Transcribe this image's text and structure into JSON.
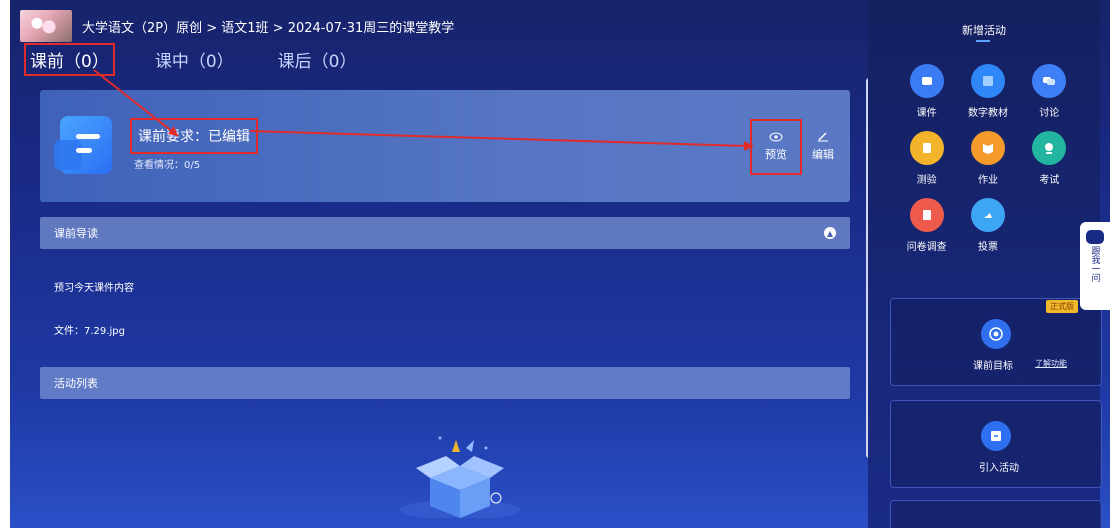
{
  "header": {
    "breadcrumb": "大学语文（2P）原创 > 语文1班 > 2024-07-31周三的课堂教学"
  },
  "tabs": [
    {
      "label": "课前（0）"
    },
    {
      "label": "课中（0）"
    },
    {
      "label": "课后（0）"
    }
  ],
  "requirement": {
    "title": "课前要求：已编辑",
    "view_status": "查看情况：0/5",
    "preview_label": "预览",
    "edit_label": "编辑"
  },
  "preview_section": {
    "title": "课前导读",
    "text": "预习今天课件内容",
    "file": "文件：7.29.jpg"
  },
  "activity_section": {
    "title": "活动列表"
  },
  "right_panel": {
    "title": "新增活动",
    "activities": [
      {
        "label": "课件",
        "icon": "courseware-icon",
        "color": "#3b7cf5"
      },
      {
        "label": "数字教材",
        "icon": "digital-textbook-icon",
        "color": "#2f86f6"
      },
      {
        "label": "讨论",
        "icon": "discussion-icon",
        "color": "#3e7ef6"
      },
      {
        "label": "测验",
        "icon": "quiz-icon",
        "color": "#f3b42c"
      },
      {
        "label": "作业",
        "icon": "homework-icon",
        "color": "#f39a2b"
      },
      {
        "label": "考试",
        "icon": "exam-icon",
        "color": "#22b5a0"
      },
      {
        "label": "问卷调查",
        "icon": "survey-icon",
        "color": "#ee5a4b"
      },
      {
        "label": "投票",
        "icon": "vote-icon",
        "color": "#3ca6f5"
      }
    ],
    "goal_label": "课前目标",
    "learn_label": "了解功能",
    "import_label": "引入活动"
  },
  "side_widget": {
    "label": "跟我一问",
    "version_tag": "正式版"
  }
}
